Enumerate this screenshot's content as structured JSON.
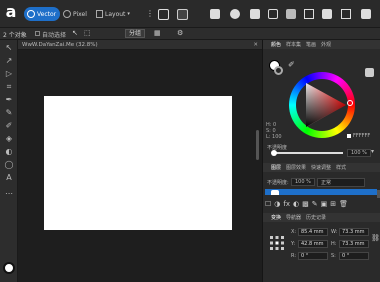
{
  "app": {
    "logo": "a"
  },
  "persona_tabs": [
    {
      "label": "Vector",
      "active": true,
      "icon": "vector-icon"
    },
    {
      "label": "Pixel",
      "active": false,
      "icon": "pixel-icon"
    },
    {
      "label": "Layout",
      "active": false,
      "icon": "layout-icon"
    }
  ],
  "context": {
    "selection": "2 个对象",
    "auto_select": "自动选择",
    "mode": "分组"
  },
  "document": {
    "title": "WwW.DaYanZai.Me (32.8%)"
  },
  "colors": {
    "accent": "#1e6fc9",
    "panel_bg": "#2a2a2a",
    "canvas_bg": "#1e1e1e",
    "page": "#ffffff",
    "hex_value": "FFFFFF"
  },
  "color_panel": {
    "tabs": [
      "颜色",
      "样本集",
      "笔画",
      "外观"
    ],
    "hsl": {
      "h": "H: 0",
      "s": "S: 0",
      "l": "L: 100"
    },
    "opacity_label": "不透明度",
    "opacity": "100 %"
  },
  "layers_panel": {
    "tabs": [
      "图层",
      "图层效果",
      "快速调整",
      "样式"
    ],
    "opacity_label": "不透明度:",
    "opacity": "100 %",
    "blend_mode": "正常"
  },
  "transform_panel": {
    "tabs": [
      "变换",
      "导航器",
      "历史记录"
    ],
    "x": "85.4 mm",
    "y": "42.8 mm",
    "w": "73.3 mm",
    "h": "73.3 mm",
    "r": "0 °",
    "s": "0 °",
    "labels": {
      "x": "X:",
      "y": "Y:",
      "w": "W:",
      "h": "H:",
      "r": "R:",
      "s": "S:"
    }
  }
}
